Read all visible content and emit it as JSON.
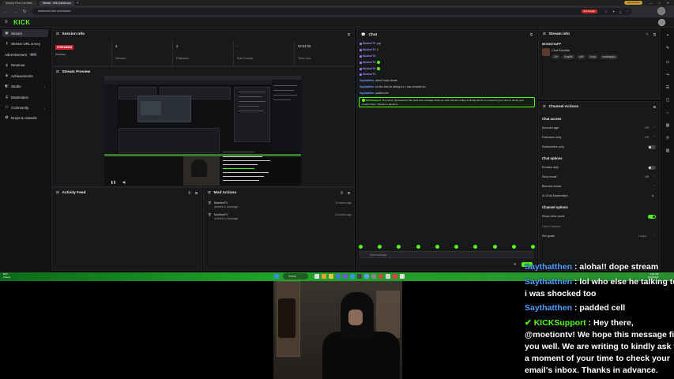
{
  "browser": {
    "tabs": [
      "Monkey Free Link Mate...",
      "Stream - Kick Dashboard"
    ],
    "url": "dashboard.kick.com/stream",
    "profile_label": "Ask Gemini",
    "google_label": "Ask Google"
  },
  "app": {
    "logo": "KICK"
  },
  "sidebar": {
    "items": [
      {
        "label": "Stream",
        "icon": "stream-icon"
      },
      {
        "label": "Stream URL & Key",
        "icon": "key-icon"
      },
      {
        "label": "Advertisement",
        "badge": "Beta",
        "icon": "ad-icon"
      },
      {
        "label": "Revenue",
        "icon": "revenue-icon"
      },
      {
        "label": "Achievements",
        "icon": "trophy-icon"
      },
      {
        "label": "Studio",
        "icon": "studio-icon",
        "expandable": true
      },
      {
        "label": "Moderation",
        "icon": "shield-icon"
      },
      {
        "label": "Community",
        "icon": "community-icon",
        "expandable": true
      },
      {
        "label": "Drops & rewards",
        "icon": "gift-icon"
      }
    ]
  },
  "session": {
    "title": "Session Info",
    "status": "STREAMING",
    "status_sub": "Session",
    "stats": [
      {
        "value": "3",
        "label": "Viewers"
      },
      {
        "value": "2",
        "label": "Followers"
      },
      {
        "value": "-",
        "label": "Sub Counts"
      },
      {
        "value": "03:54:00",
        "label": "Time Live"
      }
    ]
  },
  "preview": {
    "title": "Stream Preview"
  },
  "activity": {
    "title": "Activity Feed"
  },
  "mod_actions": {
    "title": "Mod Actions",
    "items": [
      {
        "user": "MoetionTV",
        "action": "deleted a message",
        "time": "14 hours ago"
      },
      {
        "user": "MoetionTV",
        "action": "deleted a message",
        "time": "14 hours ago"
      }
    ]
  },
  "chat": {
    "title": "Chat",
    "messages": [
      {
        "user": "MoetionTV",
        "text": "yup"
      },
      {
        "user": "MoetionTV",
        "text": "fr"
      },
      {
        "user": "MoetionTV",
        "text": ""
      },
      {
        "user": "MoetionTV",
        "text": ""
      },
      {
        "user": "MoetionTV",
        "text": ""
      },
      {
        "user": "MoetionTV",
        "text": ""
      },
      {
        "user": "Saythatthen",
        "text": "aloha!! dope stream"
      },
      {
        "user": "Saythatthen",
        "text": "lol who else he talking too. i was shocked too"
      },
      {
        "user": "Saythatthen",
        "text": "padded cell"
      }
    ],
    "support_user": "KICKSupport",
    "support_text": "Hey there, @moetiontv! We hope this message finds you well. We are writing to kindly ask for a moment of your time to check your email's inbox. Thanks in advance.",
    "input_placeholder": "Send message",
    "send_label": "Chat"
  },
  "stream_info": {
    "title": "Stream info",
    "channel": "MONKEYAPP",
    "stream_title": "Chat Roulette",
    "tags": [
      "18+",
      "English",
      "chill",
      "funny",
      "monkeyapp"
    ]
  },
  "channel_actions": {
    "title": "Channel Actions",
    "chat_access": {
      "heading": "Chat access",
      "account_age": {
        "label": "Account age",
        "value": "Off"
      },
      "followers_only": {
        "label": "Followers only",
        "value": "Off"
      },
      "subscribers_only": {
        "label": "Subscribers only",
        "on": false
      }
    },
    "chat_options": {
      "heading": "Chat options",
      "emotes_only": {
        "label": "Emotes only",
        "on": false
      },
      "slow_mode": {
        "label": "Slow mode",
        "value": "Off"
      },
      "banned_words": {
        "label": "Banned words"
      },
      "ai_moderation": {
        "label": "AI Chat Moderation"
      }
    },
    "channel_options": {
      "heading": "Channel options",
      "view_count": {
        "label": "Show view count",
        "on": true
      },
      "host_channel": {
        "label": "Host Channel"
      },
      "set_goals": {
        "label": "Set goals",
        "value": "1 active"
      }
    }
  },
  "taskbar": {
    "weather_temp": "84°F",
    "weather_desc": "Cloudy",
    "search": "Search",
    "time": "4:02 AM",
    "date": "8/25/2025"
  },
  "overlay": {
    "lines": [
      {
        "user": "Saythatthen",
        "text": " : aloha!! dope stream"
      },
      {
        "user": "Saythatthen",
        "text": " : lol who else he talking too."
      },
      {
        "user": "",
        "text": "i was shocked too"
      },
      {
        "user": "Saythatthen",
        "text": " : padded cell"
      },
      {
        "user": "KICKSupport",
        "text": " : Hey there,"
      },
      {
        "user": "",
        "text": "@moetiontv! We hope this message finds"
      },
      {
        "user": "",
        "text": "you well. We are writing to kindly ask for"
      },
      {
        "user": "",
        "text": "a moment of your time to check your"
      },
      {
        "user": "",
        "text": "email's inbox. Thanks in advance."
      }
    ]
  },
  "colors": {
    "accent": "#53fc18",
    "live": "#d01f2f",
    "username": "#4f9fff"
  }
}
